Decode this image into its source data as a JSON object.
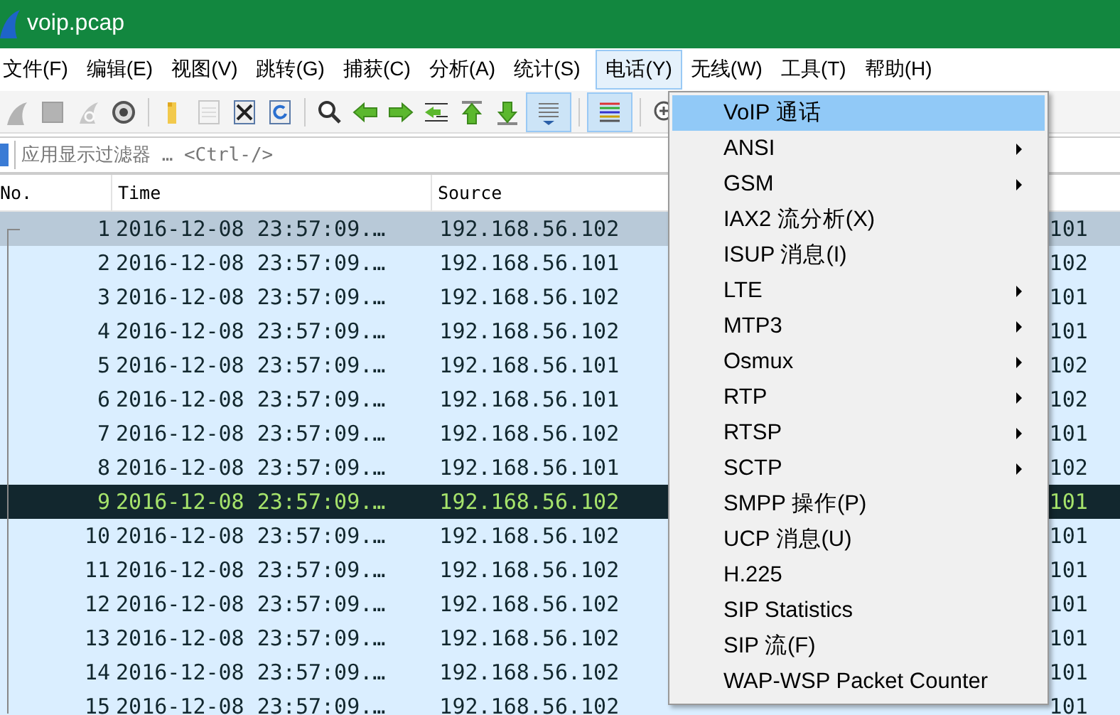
{
  "window": {
    "title": "voip.pcap"
  },
  "menubar": [
    {
      "label": "文件(F)",
      "selected": false
    },
    {
      "label": "编辑(E)",
      "selected": false
    },
    {
      "label": "视图(V)",
      "selected": false
    },
    {
      "label": "跳转(G)",
      "selected": false
    },
    {
      "label": "捕获(C)",
      "selected": false
    },
    {
      "label": "分析(A)",
      "selected": false
    },
    {
      "label": "统计(S)",
      "selected": false
    },
    {
      "label": "电话(Y)",
      "selected": true
    },
    {
      "label": "无线(W)",
      "selected": false
    },
    {
      "label": "工具(T)",
      "selected": false
    },
    {
      "label": "帮助(H)",
      "selected": false
    }
  ],
  "toolbar": [
    {
      "kind": "fin",
      "disabled": true,
      "pressed": false
    },
    {
      "kind": "stop",
      "disabled": true,
      "pressed": false
    },
    {
      "kind": "restart",
      "disabled": true,
      "pressed": false
    },
    {
      "kind": "gear",
      "disabled": false,
      "pressed": false
    },
    {
      "kind": "sep"
    },
    {
      "kind": "folder",
      "disabled": false,
      "pressed": false
    },
    {
      "kind": "file",
      "disabled": true,
      "pressed": false
    },
    {
      "kind": "closefile",
      "disabled": false,
      "pressed": false
    },
    {
      "kind": "reload",
      "disabled": false,
      "pressed": false
    },
    {
      "kind": "sep"
    },
    {
      "kind": "search",
      "disabled": false,
      "pressed": false
    },
    {
      "kind": "back",
      "disabled": false,
      "pressed": false
    },
    {
      "kind": "forward",
      "disabled": false,
      "pressed": false
    },
    {
      "kind": "jump",
      "disabled": false,
      "pressed": false
    },
    {
      "kind": "first",
      "disabled": false,
      "pressed": false
    },
    {
      "kind": "last",
      "disabled": false,
      "pressed": false
    },
    {
      "kind": "autoscroll",
      "disabled": false,
      "pressed": true
    },
    {
      "kind": "sep"
    },
    {
      "kind": "colorize",
      "disabled": false,
      "pressed": true
    },
    {
      "kind": "sep"
    },
    {
      "kind": "zoomin",
      "pressed": false
    }
  ],
  "filter": {
    "placeholder": "应用显示过滤器 … <Ctrl-/>"
  },
  "table": {
    "columns": [
      "No.",
      "Time",
      "Source"
    ],
    "rows": [
      {
        "no": "1",
        "time": "2016-12-08 23:57:09.…",
        "source": "192.168.56.102",
        "column_4": "101",
        "selected": true,
        "kind": "normal"
      },
      {
        "no": "2",
        "time": "2016-12-08 23:57:09.…",
        "source": "192.168.56.101",
        "column_4": "102",
        "selected": false,
        "kind": "normal"
      },
      {
        "no": "3",
        "time": "2016-12-08 23:57:09.…",
        "source": "192.168.56.102",
        "column_4": "101",
        "selected": false,
        "kind": "normal"
      },
      {
        "no": "4",
        "time": "2016-12-08 23:57:09.…",
        "source": "192.168.56.102",
        "column_4": "101",
        "selected": false,
        "kind": "normal"
      },
      {
        "no": "5",
        "time": "2016-12-08 23:57:09.…",
        "source": "192.168.56.101",
        "column_4": "102",
        "selected": false,
        "kind": "normal"
      },
      {
        "no": "6",
        "time": "2016-12-08 23:57:09.…",
        "source": "192.168.56.101",
        "column_4": "102",
        "selected": false,
        "kind": "normal"
      },
      {
        "no": "7",
        "time": "2016-12-08 23:57:09.…",
        "source": "192.168.56.102",
        "column_4": "101",
        "selected": false,
        "kind": "normal"
      },
      {
        "no": "8",
        "time": "2016-12-08 23:57:09.…",
        "source": "192.168.56.101",
        "column_4": "102",
        "selected": false,
        "kind": "normal"
      },
      {
        "no": "9",
        "time": "2016-12-08 23:57:09.…",
        "source": "192.168.56.102",
        "column_4": "101",
        "selected": false,
        "kind": "dark"
      },
      {
        "no": "10",
        "time": "2016-12-08 23:57:09.…",
        "source": "192.168.56.102",
        "column_4": "101",
        "selected": false,
        "kind": "normal"
      },
      {
        "no": "11",
        "time": "2016-12-08 23:57:09.…",
        "source": "192.168.56.102",
        "column_4": "101",
        "selected": false,
        "kind": "normal"
      },
      {
        "no": "12",
        "time": "2016-12-08 23:57:09.…",
        "source": "192.168.56.102",
        "column_4": "101",
        "selected": false,
        "kind": "normal"
      },
      {
        "no": "13",
        "time": "2016-12-08 23:57:09.…",
        "source": "192.168.56.102",
        "column_4": "101",
        "selected": false,
        "kind": "normal"
      },
      {
        "no": "14",
        "time": "2016-12-08 23:57:09.…",
        "source": "192.168.56.102",
        "column_4": "101",
        "selected": false,
        "kind": "normal"
      },
      {
        "no": "15",
        "time": "2016-12-08 23:57:09.…",
        "source": "192.168.56.102",
        "column_4": "101",
        "selected": false,
        "kind": "normal"
      }
    ]
  },
  "dropdown": {
    "items": [
      {
        "label": "VoIP 通话",
        "selected": true,
        "submenu": false
      },
      {
        "label": "ANSI",
        "selected": false,
        "submenu": true
      },
      {
        "label": "GSM",
        "selected": false,
        "submenu": true
      },
      {
        "label": "IAX2 流分析(X)",
        "selected": false,
        "submenu": false
      },
      {
        "label": "ISUP 消息(I)",
        "selected": false,
        "submenu": false
      },
      {
        "label": "LTE",
        "selected": false,
        "submenu": true
      },
      {
        "label": "MTP3",
        "selected": false,
        "submenu": true
      },
      {
        "label": "Osmux",
        "selected": false,
        "submenu": true
      },
      {
        "label": "RTP",
        "selected": false,
        "submenu": true
      },
      {
        "label": "RTSP",
        "selected": false,
        "submenu": true
      },
      {
        "label": "SCTP",
        "selected": false,
        "submenu": true
      },
      {
        "label": "SMPP 操作(P)",
        "selected": false,
        "submenu": false
      },
      {
        "label": "UCP 消息(U)",
        "selected": false,
        "submenu": false
      },
      {
        "label": "H.225",
        "selected": false,
        "submenu": false
      },
      {
        "label": "SIP Statistics",
        "selected": false,
        "submenu": false
      },
      {
        "label": "SIP 流(F)",
        "selected": false,
        "submenu": false
      },
      {
        "label": "WAP-WSP Packet Counter",
        "selected": false,
        "submenu": false
      }
    ]
  }
}
